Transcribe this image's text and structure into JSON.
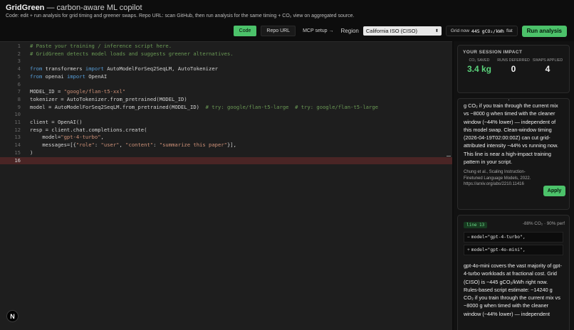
{
  "header": {
    "app_name": "GridGreen",
    "app_tagline": " — carbon-aware ML copilot",
    "subtitle": "Code: edit + run analysis for grid timing and greener swaps. Repo URL: scan GitHub, then run analysis for the same timing + CO₂ view on aggregated source."
  },
  "toolbar": {
    "tab_code": "Code",
    "tab_repo": "Repo URL",
    "mcp_setup": "MCP setup →",
    "region_label": "Region",
    "region_value": "California ISO (CISO)",
    "grid_now_label": "Grid now",
    "grid_now_value": "445",
    "grid_now_unit": "gCO₂/kWh",
    "grid_trend": "flat",
    "run_label": "Run analysis"
  },
  "editor": {
    "lines": [
      {
        "n": "1",
        "segs": [
          {
            "t": "# Paste your training / inference script here.",
            "c": "cm"
          }
        ]
      },
      {
        "n": "2",
        "segs": [
          {
            "t": "# GridGreen detects model loads and suggests greener alternatives.",
            "c": "cm"
          }
        ]
      },
      {
        "n": "3",
        "segs": []
      },
      {
        "n": "4",
        "segs": [
          {
            "t": "from",
            "c": "kw"
          },
          {
            "t": " transformers ",
            "c": ""
          },
          {
            "t": "import",
            "c": "kw"
          },
          {
            "t": " AutoModelForSeq2SeqLM, AutoTokenizer",
            "c": ""
          }
        ]
      },
      {
        "n": "5",
        "segs": [
          {
            "t": "from",
            "c": "kw"
          },
          {
            "t": " openai ",
            "c": ""
          },
          {
            "t": "import",
            "c": "kw"
          },
          {
            "t": " OpenAI",
            "c": ""
          }
        ]
      },
      {
        "n": "6",
        "segs": []
      },
      {
        "n": "7",
        "segs": [
          {
            "t": "MODEL_ID = ",
            "c": ""
          },
          {
            "t": "\"google/flan-t5-xxl\"",
            "c": "str"
          }
        ]
      },
      {
        "n": "8",
        "segs": [
          {
            "t": "tokenizer = AutoTokenizer.from_pretrained(MODEL_ID)",
            "c": ""
          }
        ]
      },
      {
        "n": "9",
        "segs": [
          {
            "t": "model = AutoModelForSeq2SeqLM.from_pretrained(MODEL_ID)  ",
            "c": ""
          },
          {
            "t": "# try: google/flan-t5-large  # try: google/flan-t5-large",
            "c": "cm"
          }
        ]
      },
      {
        "n": "10",
        "segs": []
      },
      {
        "n": "11",
        "segs": [
          {
            "t": "client = OpenAI()",
            "c": ""
          }
        ]
      },
      {
        "n": "12",
        "segs": [
          {
            "t": "resp = client.chat.completions.create(",
            "c": ""
          }
        ]
      },
      {
        "n": "13",
        "segs": [
          {
            "t": "    model=",
            "c": ""
          },
          {
            "t": "\"gpt-4-turbo\"",
            "c": "str"
          },
          {
            "t": ",",
            "c": ""
          }
        ]
      },
      {
        "n": "14",
        "segs": [
          {
            "t": "    messages=[{",
            "c": ""
          },
          {
            "t": "\"role\"",
            "c": "str"
          },
          {
            "t": ": ",
            "c": ""
          },
          {
            "t": "\"user\"",
            "c": "str"
          },
          {
            "t": ", ",
            "c": ""
          },
          {
            "t": "\"content\"",
            "c": "str"
          },
          {
            "t": ": ",
            "c": ""
          },
          {
            "t": "\"summarize this paper\"",
            "c": "str"
          },
          {
            "t": "}],",
            "c": ""
          }
        ]
      },
      {
        "n": "15",
        "segs": [
          {
            "t": ")",
            "c": ""
          }
        ]
      },
      {
        "n": "16",
        "segs": [],
        "current": true
      }
    ]
  },
  "impact": {
    "title": "YOUR SESSION IMPACT",
    "co2_label": "CO₂ SAVED",
    "co2_value": "3.4 kg",
    "runs_label": "RUNS DEFERRED",
    "runs_value": "0",
    "swaps_label": "SWAPS APPLIED",
    "swaps_value": "4"
  },
  "suggestion_1": {
    "dots": "·",
    "body": "g CO₂ if you train through the current mix vs ~8000 g when timed with the cleaner window (~44% lower) — independent of this model swap. Clean-window timing (2026-04-19T02:00:00Z) can cut grid-attributed intensity ~44% vs running now. This line is near a high-impact training pattern in your script.",
    "citation": "Chung et al., Scaling Instruction-Finetuned Language Models, 2022. https://arxiv.org/abs/2210.11416",
    "apply_label": "Apply"
  },
  "suggestion_2": {
    "line_badge": "line 13",
    "perf": "-88% CO₂ · 90% perf",
    "diff_old": "model=\"gpt-4-turbo\",",
    "diff_new": "model=\"gpt-4o-mini\",",
    "body": "gpt-4o-mini covers the vast majority of gpt-4-turbo workloads at fractional cost. Grid (CISO) is ~445 gCO₂/kWh right now. Rules-based script estimate: ~14240 g CO₂ if you train through the current mix vs ~8000 g when timed with the cleaner window (~44% lower) — independent"
  },
  "avatar": {
    "letter": "N"
  },
  "colors": {
    "accent": "#4cc26a",
    "highlight_line": "#4a2525",
    "editor_bg": "#1e1e1e"
  }
}
